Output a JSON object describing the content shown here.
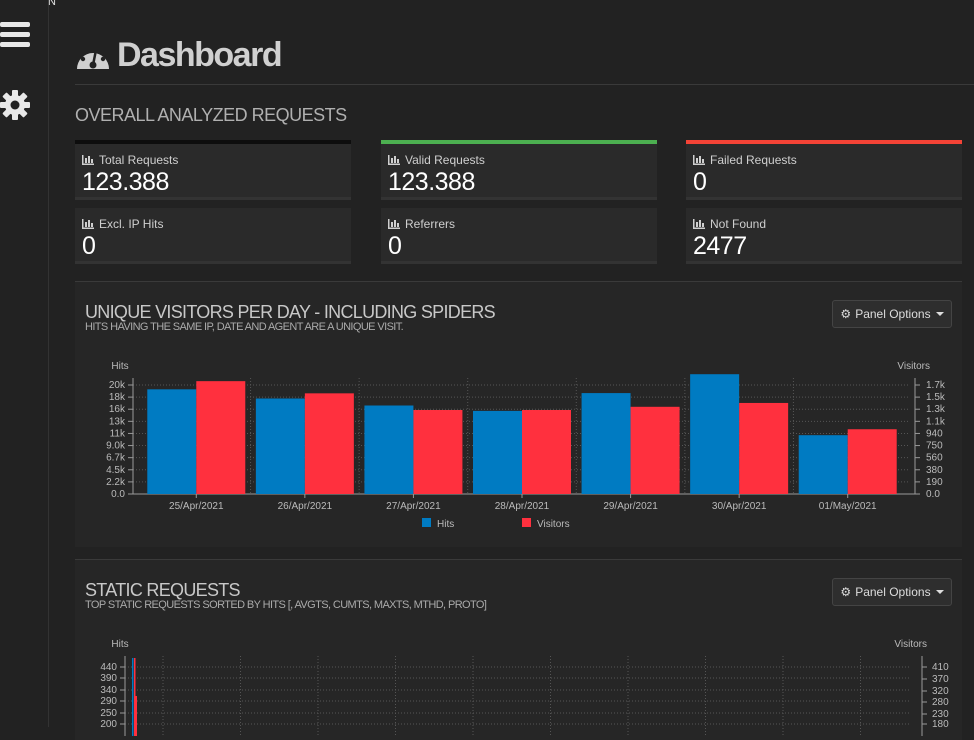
{
  "sidebar": {
    "top_char": "N",
    "items": [
      {
        "icon": "menu-icon"
      },
      {
        "icon": "gear-icon"
      }
    ]
  },
  "page": {
    "title": "Dashboard"
  },
  "overall": {
    "heading": "OVERALL ANALYZED REQUESTS",
    "cards": [
      {
        "label": "Total Requests",
        "value": "123.388",
        "accent": "#0d0d0d"
      },
      {
        "label": "Valid Requests",
        "value": "123.388",
        "accent": "#4caf50"
      },
      {
        "label": "Failed Requests",
        "value": "0",
        "accent": "#f44336"
      },
      {
        "label": "Excl. IP Hits",
        "value": "0"
      },
      {
        "label": "Referrers",
        "value": "0"
      },
      {
        "label": "Not Found",
        "value": "2477"
      }
    ]
  },
  "visitors_panel": {
    "title": "UNIQUE VISITORS PER DAY - INCLUDING SPIDERS",
    "subtitle": "HITS HAVING THE SAME IP, DATE AND AGENT ARE A UNIQUE VISIT.",
    "options_label": "Panel Options"
  },
  "static_panel": {
    "title": "STATIC REQUESTS",
    "subtitle": "TOP STATIC REQUESTS SORTED BY HITS [, AVGTS, CUMTS, MAXTS, MTHD, PROTO]",
    "options_label": "Panel Options"
  },
  "colors": {
    "hits": "#007bc2",
    "visitors": "#ff303e",
    "grid": "#555555",
    "axis": "#999999"
  },
  "chart_data": [
    {
      "type": "bar",
      "categories": [
        "25/Apr/2021",
        "26/Apr/2021",
        "27/Apr/2021",
        "28/Apr/2021",
        "29/Apr/2021",
        "30/Apr/2021",
        "01/May/2021"
      ],
      "series": [
        {
          "name": "Hits",
          "axis": "left",
          "values": [
            19400,
            17700,
            16400,
            15400,
            18700,
            22200,
            10900
          ]
        },
        {
          "name": "Visitors",
          "axis": "right",
          "values": [
            1760,
            1570,
            1310,
            1310,
            1360,
            1420,
            1010
          ]
        }
      ],
      "ylabel_left": "Hits",
      "ylabel_right": "Visitors",
      "yticks_left": [
        "0.0",
        "2.2k",
        "4.5k",
        "6.7k",
        "9.0k",
        "11k",
        "13k",
        "16k",
        "18k",
        "20k"
      ],
      "yticks_right": [
        "0.0",
        "190",
        "380",
        "560",
        "750",
        "940",
        "1.1k",
        "1.3k",
        "1.5k",
        "1.7k"
      ],
      "ylim_left": [
        0,
        20200
      ],
      "ylim_right": [
        0,
        1700
      ],
      "grid": true,
      "legend": "bottom-center"
    },
    {
      "type": "bar",
      "ylabel_left": "Hits",
      "ylabel_right": "Visitors",
      "yticks_left": [
        "200",
        "250",
        "290",
        "340",
        "390",
        "440"
      ],
      "yticks_right": [
        "180",
        "230",
        "280",
        "320",
        "370",
        "410"
      ],
      "grid": true,
      "series": [
        {
          "name": "Hits",
          "axis": "left",
          "values": [
            440
          ]
        },
        {
          "name": "Visitors",
          "axis": "right",
          "values": [
            410
          ]
        }
      ]
    }
  ]
}
